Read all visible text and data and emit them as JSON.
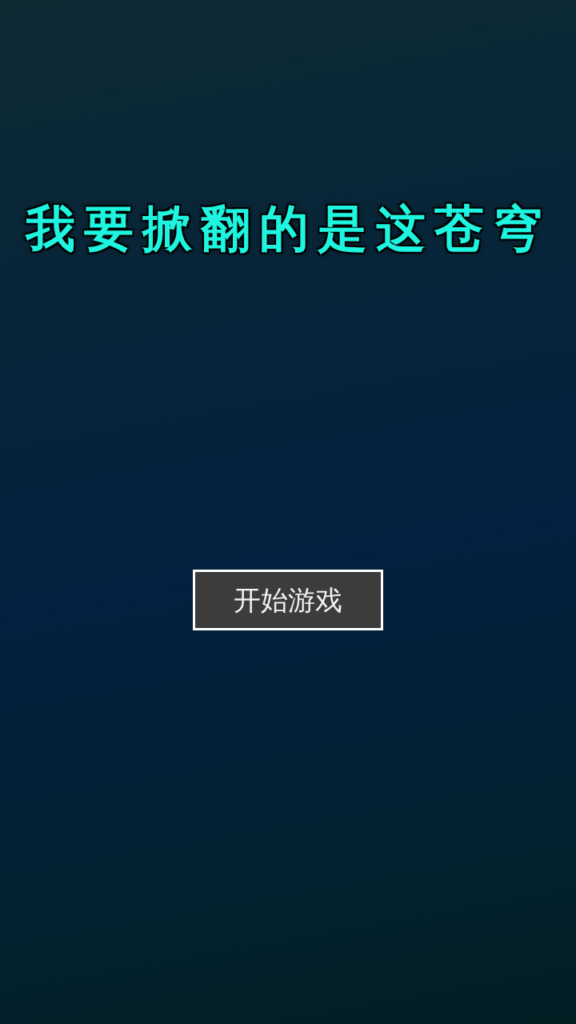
{
  "title": "我要掀翻的是这苍穹",
  "start_button": {
    "label": "开始游戏"
  }
}
